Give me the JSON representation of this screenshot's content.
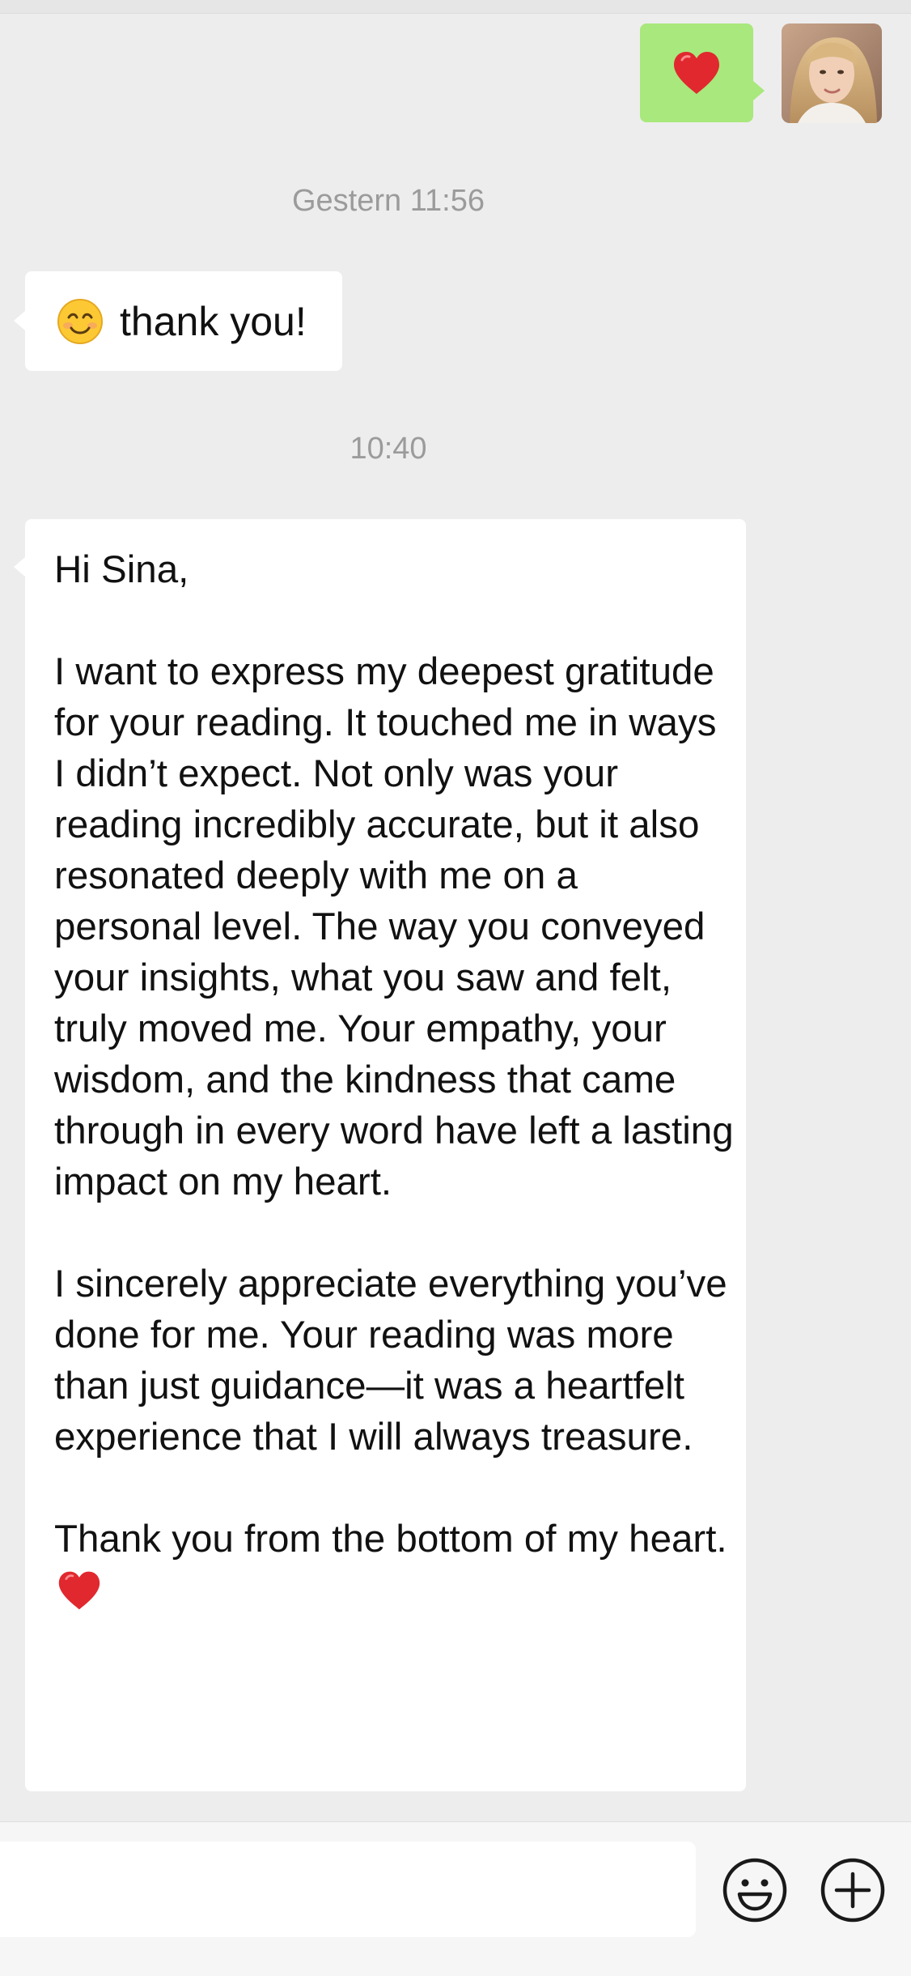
{
  "chat": {
    "messages": [
      {
        "sender": "me",
        "content": "heart-emoji"
      },
      {
        "type": "timestamp",
        "text": "Gestern 11:56"
      },
      {
        "sender": "contact",
        "emoji": "smiling-face-emoji",
        "text": "thank you!"
      },
      {
        "type": "timestamp",
        "text": "10:40"
      },
      {
        "sender": "contact",
        "paragraphs": [
          "Hi Sina,",
          "I want to express my deepest gratitude for your reading. It touched me in ways I didn’t expect. Not only was your reading incredibly accurate, but it also resonated deeply with me on a personal level. The way you conveyed your insights, what you saw and felt, truly moved me. Your empathy, your wisdom, and the kindness that came through in every word have left a lasting impact on my heart.",
          "I sincerely appreciate everything you’ve done for me. Your reading was more than just guidance—it was a heartfelt experience that I will always treasure.",
          "Thank you from the bottom of my heart."
        ],
        "trailing_emoji": "heart-emoji"
      }
    ]
  },
  "input_bar": {
    "value": "",
    "icons": [
      "smiley-face-icon",
      "plus-icon"
    ]
  },
  "colors": {
    "background": "#ededed",
    "sent_bubble": "#a9e87c",
    "received_bubble": "#ffffff",
    "timestamp_text": "#9b9b9b",
    "heart": "#e0282e"
  }
}
